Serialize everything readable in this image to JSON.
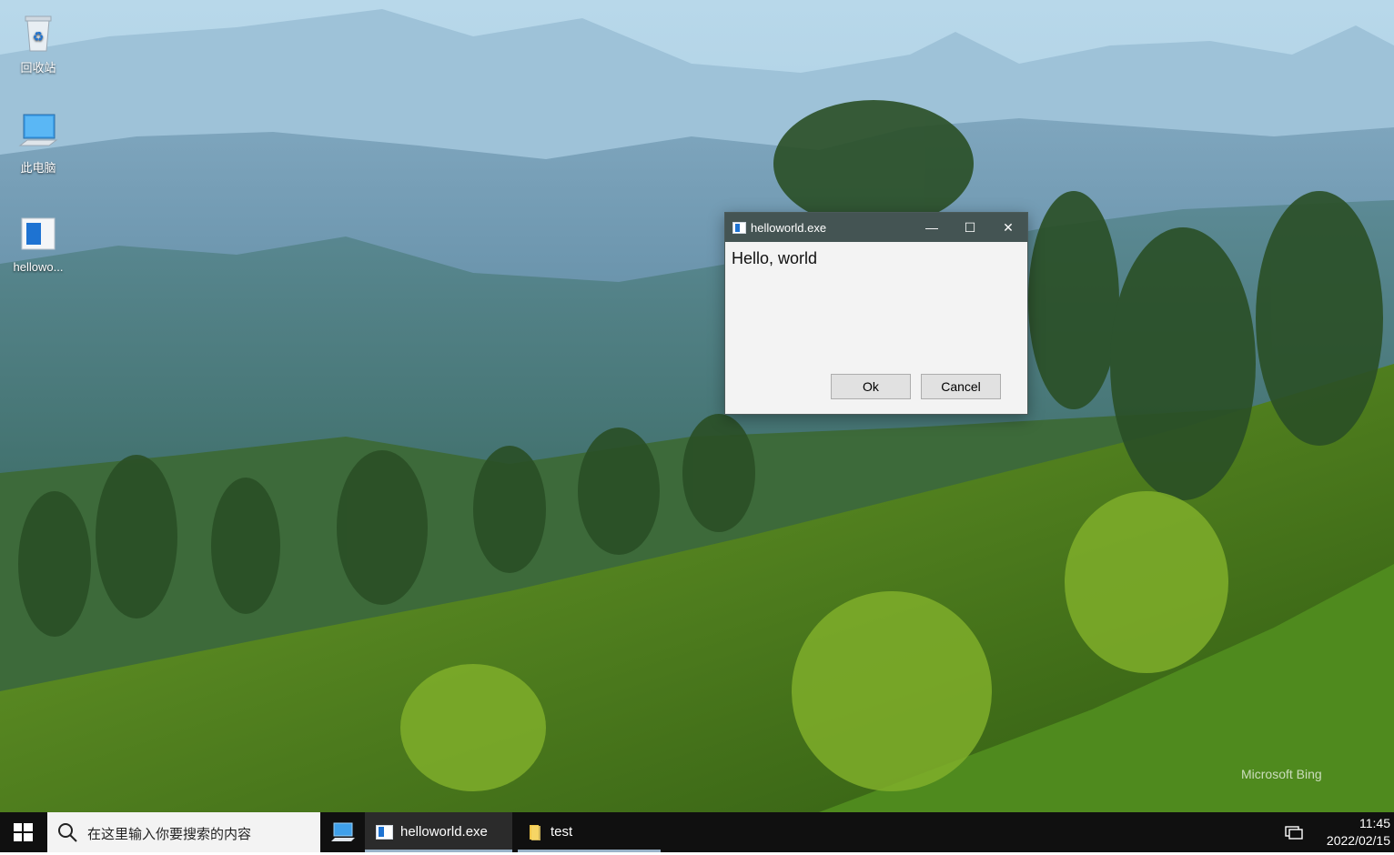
{
  "desktop": {
    "icons": [
      {
        "label": "回收站",
        "icon": "recycle-bin-icon"
      },
      {
        "label": "此电脑",
        "icon": "computer-icon"
      },
      {
        "label": "hellowo...",
        "icon": "app-file-icon"
      }
    ],
    "watermark": "Microsoft Bing"
  },
  "dialog": {
    "title": "helloworld.exe",
    "message": "Hello, world",
    "ok_label": "Ok",
    "cancel_label": "Cancel",
    "minimize_glyph": "—",
    "maximize_glyph": "☐",
    "close_glyph": "✕"
  },
  "taskbar": {
    "search_placeholder": "在这里输入你要搜索的内容",
    "items": [
      {
        "label": "helloworld.exe",
        "icon": "app-window-icon"
      },
      {
        "label": "test",
        "icon": "folder-icon"
      }
    ],
    "clock_time": "11:45",
    "clock_date": "2022/02/15"
  },
  "colors": {
    "titlebar": "#445453",
    "taskbar": "#101010",
    "accent": "#1e73d2"
  }
}
